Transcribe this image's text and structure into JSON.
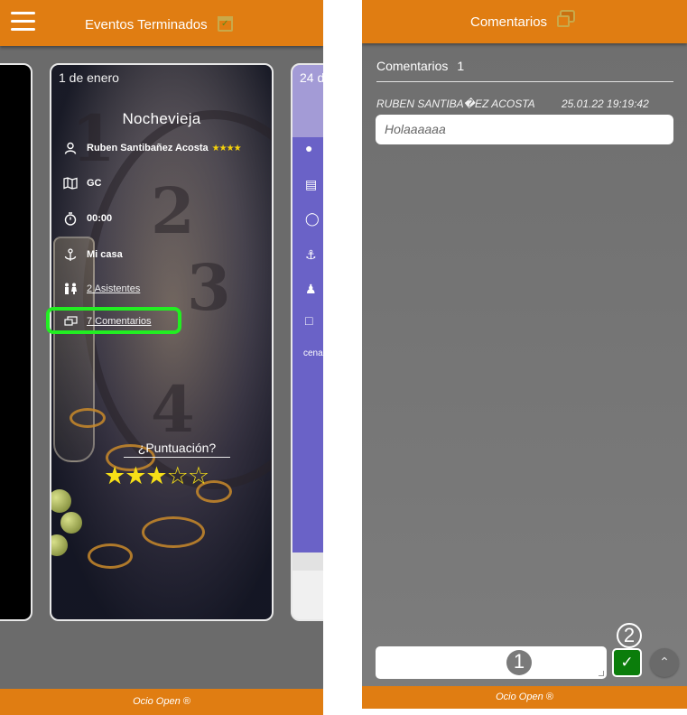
{
  "left_screen": {
    "header": {
      "title": "Eventos Terminados",
      "menu_icon": "hamburger-icon",
      "title_icon": "calendar-check-icon"
    },
    "event_card": {
      "date": "1 de enero",
      "title": "Nochevieja",
      "organizer": "Ruben Santibañez Acosta",
      "organizer_stars": "★★★★",
      "location": "GC",
      "time": "00:00",
      "place": "Mi casa",
      "attendees_link": "2 Asistentes",
      "comments_link": "7 Comentarios",
      "rating_label": "¿Puntuación?",
      "rating": {
        "value": 3,
        "max": 5,
        "filled": "★★★",
        "empty": "☆☆"
      }
    },
    "next_card": {
      "date": "24 d",
      "snippet": "cena"
    },
    "footer": "Ocio Open ®"
  },
  "right_screen": {
    "header": {
      "title": "Comentarios",
      "title_icon": "chat-bubbles-icon"
    },
    "comments_section": {
      "label": "Comentarios",
      "count": "1",
      "items": [
        {
          "author": "RUBEN SANTIBA�EZ ACOSTA",
          "timestamp": "25.01.22 19:19:42",
          "text": "Holaaaaaa"
        }
      ]
    },
    "reply": {
      "input_value": "",
      "send_icon": "check-icon",
      "scroll_icon": "chevron-up-icon"
    },
    "markers": {
      "input": "1",
      "send": "2"
    },
    "footer": "Ocio Open ®"
  },
  "colors": {
    "accent": "#e07d12",
    "highlight": "#22ee22",
    "send": "#0b7d0b",
    "star": "#f7e017"
  }
}
